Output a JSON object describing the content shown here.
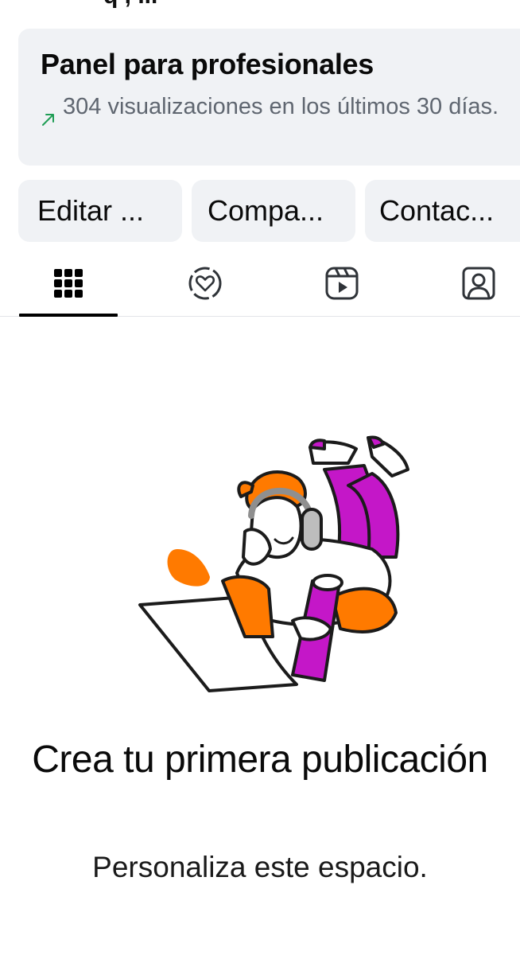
{
  "top_partial_text": "  q          ,          ...",
  "dashboard": {
    "title": "Panel para profesionales",
    "subtitle": "304 visualizaciones en los últimos 30 días.",
    "trend_icon": "arrow-up-right-icon",
    "trend_color": "#1f9d55"
  },
  "buttons": [
    {
      "label": "Editar ..."
    },
    {
      "label": "Compa..."
    },
    {
      "label": "Contac..."
    }
  ],
  "tabs": [
    {
      "icon": "grid-icon",
      "active": true
    },
    {
      "icon": "story-highlights-icon",
      "active": false
    },
    {
      "icon": "reels-icon",
      "active": false
    },
    {
      "icon": "tagged-photos-icon",
      "active": false
    }
  ],
  "empty_state": {
    "title": "Crea tu primera publicación",
    "subtitle": "Personaliza este espacio."
  },
  "colors": {
    "card_bg": "#f0f2f5",
    "accent_orange": "#ff7a00",
    "accent_magenta": "#c417c8",
    "subtitle_gray": "#5f6670"
  }
}
